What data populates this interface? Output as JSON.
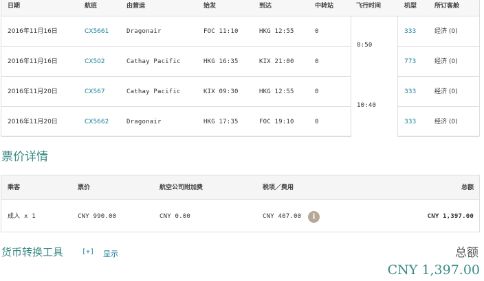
{
  "flights": {
    "headers": [
      "日期",
      "航班",
      "由营运",
      "始发",
      "到达",
      "中转站",
      "飞行时间",
      "机型",
      "所订客舱"
    ],
    "rows": [
      {
        "date": "2016年11月16日",
        "flight": "CX5661",
        "operator": "Dragonair",
        "depart": "FOC 11:10",
        "arrive": "HKG 12:55",
        "stops": "0",
        "aircraft": "333",
        "cabin": "经济 (0)"
      },
      {
        "date": "2016年11月16日",
        "flight": "CX502",
        "operator": "Cathay Pacific",
        "depart": "HKG 16:35",
        "arrive": "KIX 21:00",
        "stops": "0",
        "aircraft": "773",
        "cabin": "经济 (0)"
      },
      {
        "date": "2016年11月20日",
        "flight": "CX567",
        "operator": "Cathay Pacific",
        "depart": "KIX 09:30",
        "arrive": "HKG 12:55",
        "stops": "0",
        "aircraft": "333",
        "cabin": "经济 (0)"
      },
      {
        "date": "2016年11月20日",
        "flight": "CX5662",
        "operator": "Dragonair",
        "depart": "HKG 17:35",
        "arrive": "FOC 19:10",
        "stops": "0",
        "aircraft": "333",
        "cabin": "经济 (0)"
      }
    ],
    "durations": [
      "8:50",
      "10:40"
    ]
  },
  "fare": {
    "title": "票价详情",
    "headers": [
      "乘客",
      "票价",
      "航空公司附加费",
      "税项／费用",
      "总额"
    ],
    "row": {
      "passenger": "成人 x 1",
      "fare": "CNY 990.00",
      "surcharge": "CNY 0.00",
      "taxes": "CNY 407.00",
      "total": "CNY 1,397.00"
    },
    "info_icon": "i"
  },
  "currency": {
    "title": "货币转换工具",
    "toggle": "[+]",
    "show": "显示"
  },
  "total": {
    "label": "总额",
    "value": "CNY 1,397.00"
  },
  "colors": {
    "accent": "#3a8a86",
    "link": "#1b7f9a",
    "info_icon_bg": "#b5a898"
  }
}
